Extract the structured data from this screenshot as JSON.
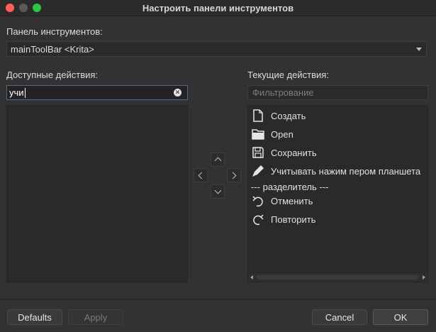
{
  "window": {
    "title": "Настроить панели инструментов"
  },
  "toolbar_section": {
    "label": "Панель инструментов:",
    "selected": "mainToolBar <Krita>"
  },
  "available": {
    "label": "Доступные действия:",
    "search_value": "учи"
  },
  "current": {
    "label": "Текущие действия:",
    "filter_placeholder": "Фильтрование",
    "items": [
      {
        "label": "Создать",
        "icon": "new-document-icon"
      },
      {
        "label": "Open",
        "icon": "folder-icon"
      },
      {
        "label": "Сохранить",
        "icon": "save-icon"
      },
      {
        "label": "Учитывать нажим пером планшета",
        "icon": "pen-pressure-icon"
      },
      {
        "label": "--- разделитель ---",
        "icon": ""
      },
      {
        "label": "Отменить",
        "icon": "undo-icon"
      },
      {
        "label": "Повторить",
        "icon": "redo-icon"
      }
    ]
  },
  "buttons": {
    "defaults": "Defaults",
    "apply": "Apply",
    "cancel": "Cancel",
    "ok": "OK"
  }
}
